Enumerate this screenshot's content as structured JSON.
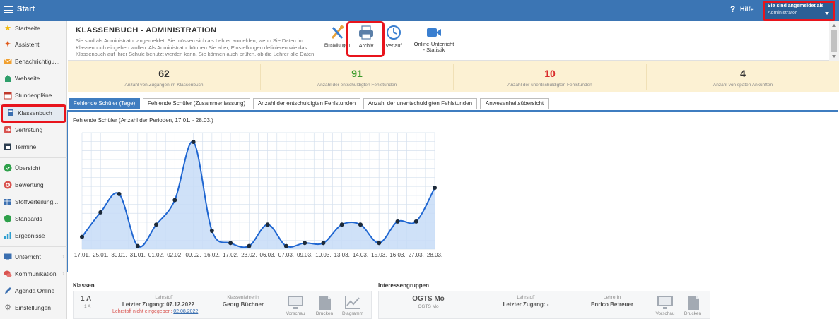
{
  "topbar": {
    "start_label": "Start",
    "help_label": "Hilfe",
    "login_title": "Sie sind angemeldet als",
    "login_user": "Administrator"
  },
  "sidebar": {
    "items": [
      {
        "label": "Startseite",
        "icon": "star-icon",
        "color": "#f2b705"
      },
      {
        "label": "Assistent",
        "icon": "wand-icon",
        "color": "#e05a1a"
      },
      {
        "label": "Benachrichtigu...",
        "icon": "envelope-icon",
        "color": "#f0a030"
      },
      {
        "label": "Webseite",
        "icon": "home-icon",
        "color": "#2e9e6a"
      },
      {
        "label": "Stundenpläne ...",
        "icon": "calendar-icon",
        "color": "#c0392b"
      },
      {
        "label": "Klassenbuch",
        "icon": "book-icon",
        "color": "#3b6fb0"
      },
      {
        "label": "Vertretung",
        "icon": "swap-icon",
        "color": "#d9534f"
      },
      {
        "label": "Termine",
        "icon": "calendar-dark-icon",
        "color": "#2c3e50"
      },
      {
        "label": "Übersicht",
        "icon": "check-circle-icon",
        "color": "#2ea04a"
      },
      {
        "label": "Bewertung",
        "icon": "target-icon",
        "color": "#d9534f"
      },
      {
        "label": "Stoffverteilung...",
        "icon": "table-icon",
        "color": "#3b6fb0"
      },
      {
        "label": "Standards",
        "icon": "shield-icon",
        "color": "#2ea04a"
      },
      {
        "label": "Ergebnisse",
        "icon": "bar-chart-icon",
        "color": "#2f9fd0"
      },
      {
        "label": "Unterricht",
        "icon": "monitor-icon",
        "color": "#3b6fb0"
      },
      {
        "label": "Kommunikation",
        "icon": "chat-icon",
        "color": "#d9534f"
      },
      {
        "label": "Agenda Online",
        "icon": "pencil-icon",
        "color": "#3b6fb0"
      },
      {
        "label": "Einstellungen",
        "icon": "gear-icon",
        "color": "#777777"
      }
    ],
    "arrow": "›"
  },
  "header": {
    "title": "KLASSENBUCH - ADMINISTRATION",
    "description": "Sie sind als Administrator angemeldet. Sie müssen sich als Lehrer anmelden, wenn Sie Daten im Klassenbuch eingeben wollen. Als Administrator können Sie aber, Einstellungen definieren wie das Klassenbuch auf Ihrer Schule benutzt werden kann. Sie können auch prüfen, ob die Lehrer alle Daten ausgefüllt haben.",
    "tools": {
      "settings": "Einstellungen",
      "archive": "Archiv",
      "history": "Verlauf",
      "online_line1": "Online-Unterricht",
      "online_line2": "- Statistik"
    }
  },
  "stats": [
    {
      "value": "62",
      "label": "Anzahl von Zugängen im Klassenbuch",
      "color": "#333333"
    },
    {
      "value": "91",
      "label": "Anzahl der entschuldigten Fehlstunden",
      "color": "#3a9a2a"
    },
    {
      "value": "10",
      "label": "Anzahl der unentschuldigten Fehlstunden",
      "color": "#d92b2b"
    },
    {
      "value": "4",
      "label": "Anzahl von späten Ankünften",
      "color": "#333333"
    }
  ],
  "tabs": [
    "Fehlende Schüler (Tage)",
    "Fehlende Schüler (Zusammenfassung)",
    "Anzahl der entschuldigten Fehlstunden",
    "Anzahl der unentschuldigten Fehlstunden",
    "Anwesenheitsübersicht"
  ],
  "chart_data": {
    "type": "area",
    "title": "Fehlende Schüler (Anzahl der Perioden, 17.01. - 28.03.)",
    "categories": [
      "17.01.",
      "25.01.",
      "30.01.",
      "31.01.",
      "01.02.",
      "02.02.",
      "09.02.",
      "16.02.",
      "17.02.",
      "23.02.",
      "06.03.",
      "07.03.",
      "09.03.",
      "10.03.",
      "13.03.",
      "14.03.",
      "15.03.",
      "16.03.",
      "27.03.",
      "28.03."
    ],
    "values": [
      2,
      6,
      9,
      0.5,
      4,
      8,
      17.5,
      3,
      1,
      0.5,
      4,
      0.5,
      1,
      1,
      4,
      4,
      1,
      4.5,
      4.5,
      10
    ],
    "ylim": [
      0,
      19
    ],
    "grid": true,
    "colors": {
      "line": "#1f66d1",
      "fill": "#c7dcf7",
      "point": "#1c2a3a",
      "grid": "#d5e0ee"
    }
  },
  "bottom": {
    "klassen": {
      "title": "Klassen",
      "class_name": "1 A",
      "class_sub": "1 A",
      "lehrstoff": "Lehrstoff",
      "last_access": "Letzter Zugang: 07.12.2022",
      "missing_prefix": "Lehrstoff nicht eingegeben: ",
      "missing_date": "02.08.2022",
      "teacher_label": "KlassenlehrerIn",
      "teacher_name": "Georg Büchner",
      "actions": [
        "Vorschau",
        "Drucken",
        "Diagramm"
      ]
    },
    "interessengruppen": {
      "title": "Interessengruppen",
      "group_name": "OGTS Mo",
      "group_sub": "OGTS Mo",
      "lehrstoff": "Lehrstoff",
      "last_access": "Letzter Zugang: -",
      "teacher_label": "LehrerIn",
      "teacher_name": "Enrico Betreuer",
      "actions": [
        "Vorschau",
        "Drucken"
      ]
    }
  }
}
